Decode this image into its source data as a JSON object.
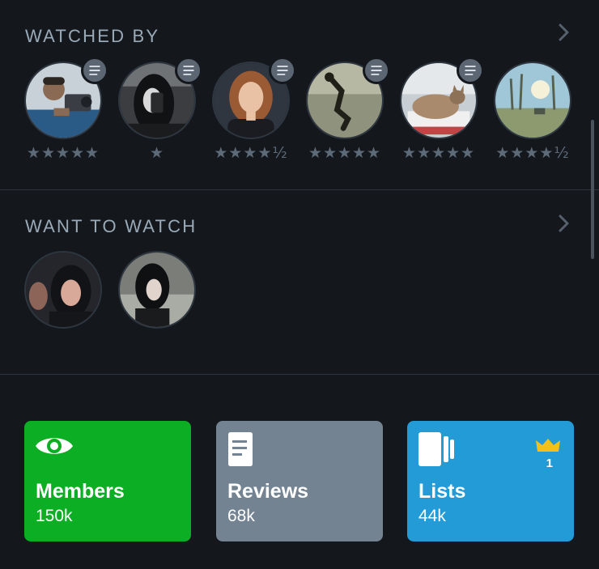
{
  "watched_by": {
    "title": "WATCHED BY",
    "members": [
      {
        "name": "member-1",
        "rating": "★★★★★",
        "has_review": true
      },
      {
        "name": "member-2",
        "rating": "★",
        "has_review": true
      },
      {
        "name": "member-3",
        "rating": "★★★★½",
        "has_review": true
      },
      {
        "name": "member-4",
        "rating": "★★★★★",
        "has_review": true
      },
      {
        "name": "member-5",
        "rating": "★★★★★",
        "has_review": true
      },
      {
        "name": "member-6",
        "rating": "★★★★½",
        "has_review": false
      }
    ]
  },
  "want_to_watch": {
    "title": "WANT TO WATCH",
    "members": [
      {
        "name": "member-7"
      },
      {
        "name": "member-8"
      }
    ]
  },
  "stats": {
    "members": {
      "label": "Members",
      "count": "150k",
      "color": "#0cae23",
      "icon": "eye-icon"
    },
    "reviews": {
      "label": "Reviews",
      "count": "68k",
      "color": "#748392",
      "icon": "document-icon"
    },
    "lists": {
      "label": "Lists",
      "count": "44k",
      "color": "#229bd6",
      "icon": "list-stack-icon",
      "crown_count": "1"
    }
  }
}
